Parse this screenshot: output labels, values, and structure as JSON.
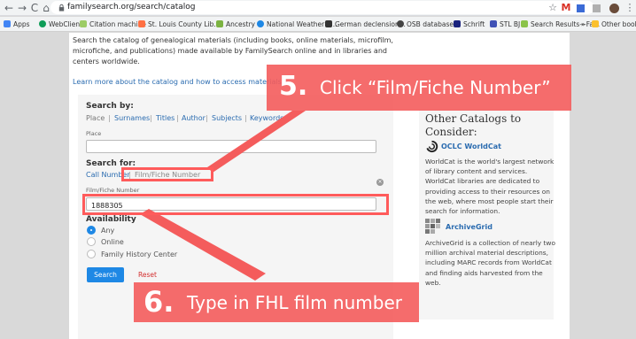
{
  "browser": {
    "nav": {
      "back": "←",
      "forward": "→",
      "reload": "C",
      "home": "⌂"
    },
    "url": "familysearch.org/search/catalog",
    "bookmarks": [
      {
        "label": "Apps",
        "color": "#4285f4"
      },
      {
        "label": "WebClient",
        "color": "#0f9d58"
      },
      {
        "label": "Citation machine",
        "color": "#9ccc65"
      },
      {
        "label": "St. Louis County Lib...",
        "color": "#ff7043"
      },
      {
        "label": "Ancestry",
        "color": "#7cb342"
      },
      {
        "label": "National Weather S...",
        "color": "#1e88e5"
      },
      {
        "label": "German declension...",
        "color": "#333333"
      },
      {
        "label": "OSB database",
        "color": "#444444"
      },
      {
        "label": "Schrift",
        "color": "#1a237e"
      },
      {
        "label": "STL BJ",
        "color": "#3f51b5"
      },
      {
        "label": "Search Results—Fa...",
        "color": "#8bc34a"
      },
      {
        "label": "»",
        "color": ""
      },
      {
        "label": "Other bookmarks",
        "color": "#fbc02d"
      }
    ]
  },
  "intro": {
    "line1": "Search the catalog of genealogical materials (including books, online materials, microfilm,",
    "line2": "microfiche, and publications) made available by FamilySearch online and in libraries and",
    "line3": "centers worldwide.",
    "learn_more": "Learn more about the catalog and how to access materials."
  },
  "search": {
    "search_by_label": "Search by:",
    "search_by_options": [
      "Place",
      "Surnames",
      "Titles",
      "Author",
      "Subjects",
      "Keywords"
    ],
    "place_label": "Place",
    "search_for_label": "Search for:",
    "search_for_options": [
      "Call Number",
      "Film/Fiche Number"
    ],
    "film_label": "Film/Fiche Number",
    "film_value": "1888305",
    "availability_label": "Availability",
    "availability_options": [
      "Any",
      "Online",
      "Family History Center"
    ],
    "availability_selected": "Any",
    "search_button": "Search",
    "reset_link": "Reset"
  },
  "other_catalogs": {
    "title": "Other Catalogs to Consider:",
    "oclc_name": "OCLC WorldCat",
    "oclc_desc": "WorldCat is the world's largest network of library content and services. WorldCat libraries are dedicated to providing access to their resources on the web, where most people start their search for information.",
    "archivegrid_name": "ArchiveGrid",
    "archivegrid_desc": "ArchiveGrid is a collection of nearly two million archival material descriptions, including MARC records from WorldCat and finding aids harvested from the web."
  },
  "annotations": {
    "step5_num": "5.",
    "step5_text": "Click “Film/Fiche Number”",
    "step6_num": "6.",
    "step6_text": "Type in FHL film number",
    "color": "#f45c5c"
  }
}
